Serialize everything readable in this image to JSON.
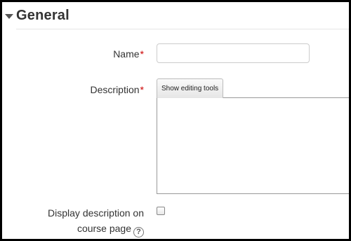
{
  "section": {
    "title": "General",
    "icon": "triangle-down-icon"
  },
  "form": {
    "name_label": "Name",
    "name_value": "",
    "required_marker": "*",
    "description_label": "Description",
    "editor_toggle_label": "Show editing tools",
    "description_value": "",
    "display_label_line1": "Display description on",
    "display_label_line2": "course page",
    "display_checked": false,
    "help_icon": "question-circle-icon",
    "help_glyph": "?"
  }
}
